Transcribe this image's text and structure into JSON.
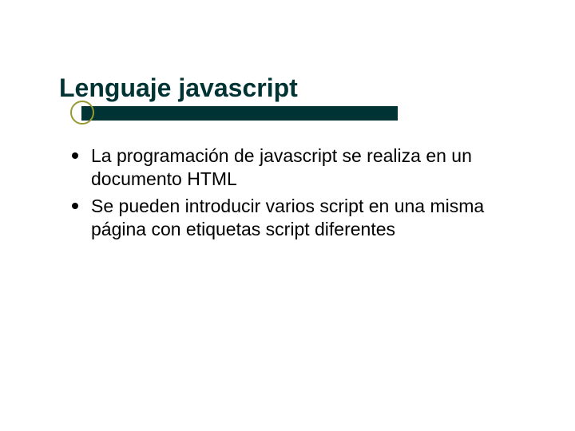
{
  "slide": {
    "title": "Lenguaje javascript",
    "bullets": [
      "La programación de javascript se realiza en un documento HTML",
      "Se pueden introducir varios script en una misma página con etiquetas script diferentes"
    ]
  },
  "colors": {
    "accent_dark": "#003333",
    "accent_olive": "#999933"
  }
}
